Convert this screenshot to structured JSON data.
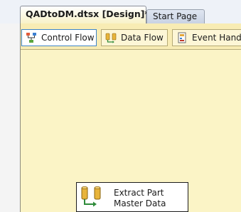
{
  "document_tabs": {
    "active_label": "QADtoDM.dtsx [Design]*",
    "other_label": "Start Page"
  },
  "designer_tabs": [
    {
      "label": "Control Flow",
      "icon": "control-flow-icon"
    },
    {
      "label": "Data Flow",
      "icon": "data-flow-icon"
    },
    {
      "label": "Event Hand",
      "icon": "event-handlers-icon"
    }
  ],
  "canvas": {
    "task": {
      "line1": "Extract Part",
      "line2": "Master Data",
      "icon": "data-flow-task-icon"
    }
  },
  "colors": {
    "canvas_bg": "#fbf4c6",
    "tab_strip_bg": "#eef2f8",
    "active_tab_border": "#3e84c6"
  }
}
